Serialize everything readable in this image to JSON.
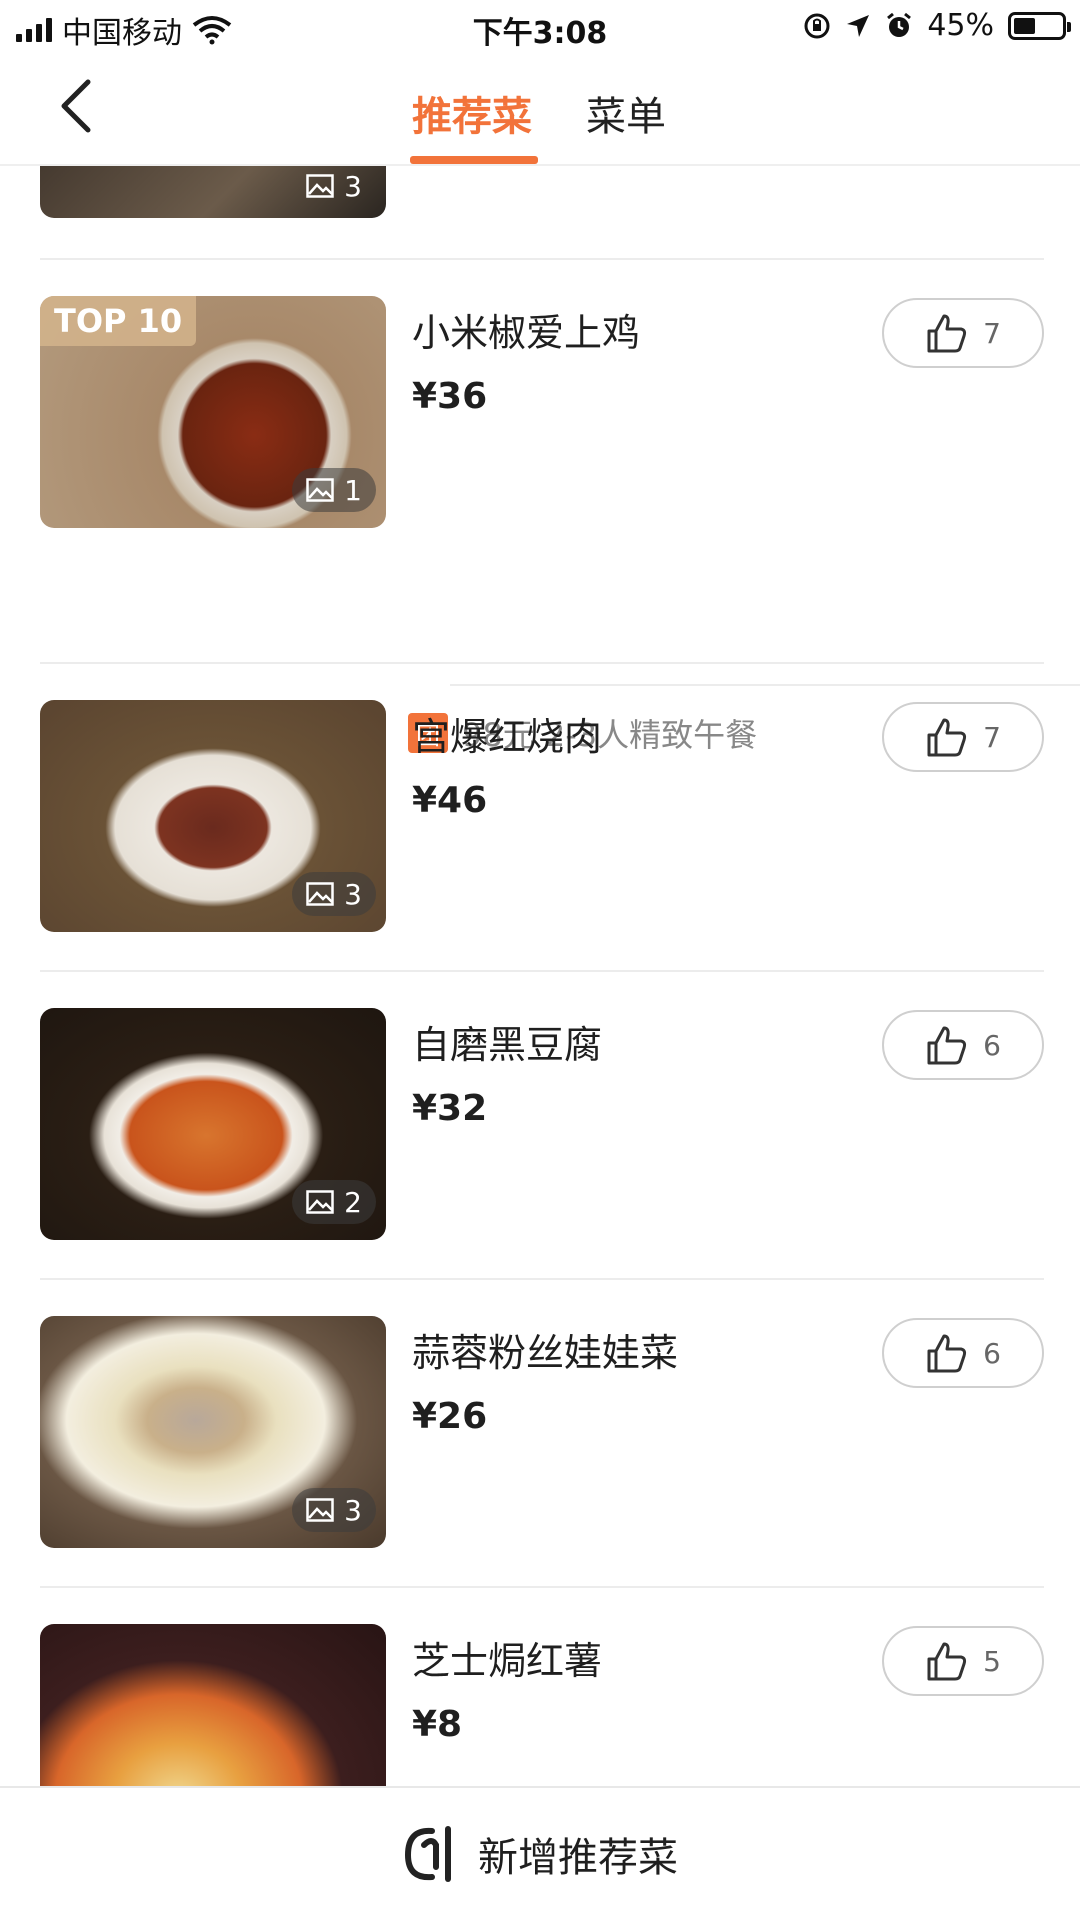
{
  "status_bar": {
    "carrier": "中国移动",
    "time": "下午3:08",
    "battery_percent": "45%",
    "battery_level": 0.45
  },
  "header": {
    "tabs": [
      {
        "label": "推荐菜",
        "active": true
      },
      {
        "label": "菜单",
        "active": false
      }
    ],
    "accent_color": "#f2733a"
  },
  "partial_item": {
    "photo_count": "3"
  },
  "dishes": [
    {
      "name": "小米椒爱上鸡",
      "price": "¥36",
      "likes": "7",
      "photo_count": "1",
      "badge": "TOP 10"
    },
    {
      "name": "宫爆红烧肉",
      "price": "¥46",
      "likes": "7",
      "photo_count": "3"
    },
    {
      "name": "自磨黑豆腐",
      "price": "¥32",
      "likes": "6",
      "photo_count": "2"
    },
    {
      "name": "蒜蓉粉丝娃娃菜",
      "price": "¥26",
      "likes": "6",
      "photo_count": "3"
    },
    {
      "name": "芝士焗红薯",
      "price": "¥8",
      "likes": "5",
      "photo_count": ""
    }
  ],
  "deal": {
    "icon_label": "团",
    "text": "98元 2-3人精致午餐"
  },
  "bottom_bar": {
    "label": "新增推荐菜"
  },
  "icons": {
    "back": "chevron-left-icon",
    "like": "thumbs-up-icon",
    "photos": "image-icon",
    "add": "add-dish-icon",
    "wifi": "wifi-icon",
    "battery": "battery-icon",
    "signal": "signal-icon"
  }
}
